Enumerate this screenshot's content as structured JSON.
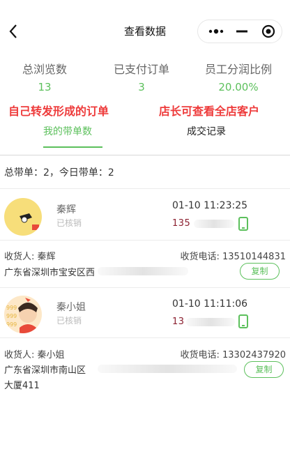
{
  "nav": {
    "title": "查看数据"
  },
  "stats": [
    {
      "label": "总浏览数",
      "value": "13"
    },
    {
      "label": "已支付订单",
      "value": "3"
    },
    {
      "label": "员工分润比例",
      "value": "20.00%"
    }
  ],
  "notes": {
    "left": "自己转发形成的订单",
    "right": "店长可查看全店客户"
  },
  "tabs": {
    "active": "我的带单数",
    "inactive": "成交记录"
  },
  "summary": "总带单：2，今日带单：2",
  "orders": [
    {
      "name": "秦辉",
      "status": "已核销",
      "time": "01-10 11:23:25",
      "phone_masked": "135",
      "receiver": "收货人: 秦辉",
      "receiver_phone": "收货电话: 13510144831",
      "address": "广东省深圳市宝安区西",
      "copy_label": "复制"
    },
    {
      "name": "秦小姐",
      "status": "已核销",
      "time": "01-10 11:11:06",
      "phone_masked": "13",
      "receiver": "收货人: 秦小姐",
      "receiver_phone": "收货电话: 13302437920",
      "address": "广东省深圳市南山区",
      "address_tail": "大厦411",
      "copy_label": "复制"
    }
  ],
  "colors": {
    "accent": "#5cc05c",
    "note_red": "#ee3a3a",
    "phone_red": "#8b2030"
  }
}
